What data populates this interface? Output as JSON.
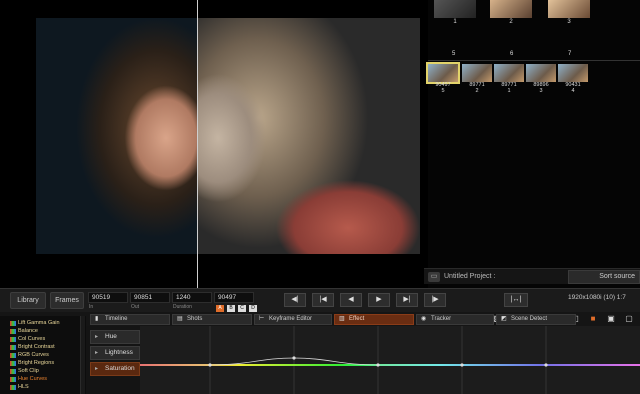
{
  "browser": {
    "top_thumbs": [
      {
        "label": "1"
      },
      {
        "label": "2"
      },
      {
        "label": "3"
      }
    ],
    "slot_labels": [
      "5",
      "6",
      "7"
    ],
    "clips": [
      {
        "id": "90497",
        "sub": "5"
      },
      {
        "id": "89771",
        "sub": "2"
      },
      {
        "id": "89771",
        "sub": "1"
      },
      {
        "id": "89896",
        "sub": "3"
      },
      {
        "id": "90431",
        "sub": "4"
      }
    ]
  },
  "project": {
    "title": "Untitled Project :",
    "sort_label": "Sort source"
  },
  "transport": {
    "library_label": "Library",
    "frames_label": "Frames",
    "in_value": "90519",
    "out_value": "90851",
    "duration_value": "1240",
    "current_value": "90497",
    "in_caption": "In",
    "out_caption": "Out",
    "duration_caption": "Duration",
    "letters": [
      "A",
      "B",
      "C",
      "D"
    ],
    "resolution": "1920x1080i (10) 1:7"
  },
  "tabs": [
    "Timeline",
    "Shots",
    "Keyframe Editor",
    "Effect",
    "Tracker",
    "Scene Detect"
  ],
  "effects": [
    "Lift Gamma Gain",
    "Balance",
    "Col Curves",
    "Bright Contrast",
    "RGB Curves",
    "Bright Regions",
    "Soft Clip",
    "Hue Curves",
    "HLS"
  ],
  "channels": [
    "Hue",
    "Lightness",
    "Saturation"
  ],
  "colors": {
    "accent": "#e06d2a",
    "active_tab": "#6a2d12",
    "selection": "#e2d36a"
  }
}
